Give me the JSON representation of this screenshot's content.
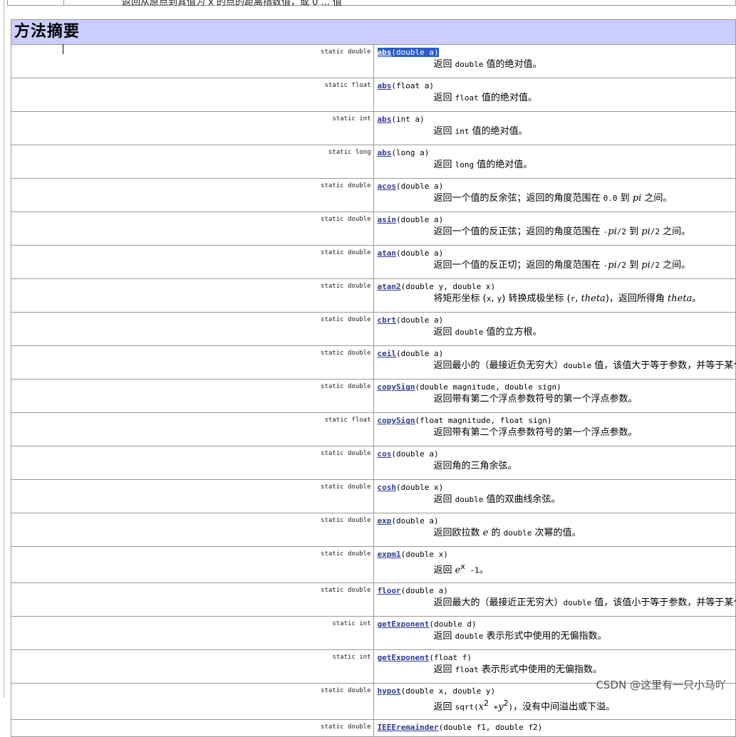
{
  "page": {
    "section_title": "方法摘要",
    "watermark": "CSDN @这里有一只小马吖"
  },
  "top_clip_text": "返回从原点到其值为 x 的点的距离指数值，或 0 ... 值",
  "methods": [
    {
      "type": "static double",
      "name": "abs",
      "params": "(double a)",
      "selected": true,
      "desc": [
        {
          "t": "返回 "
        },
        {
          "c": "double"
        },
        {
          "t": " 值的绝对值。"
        }
      ]
    },
    {
      "type": "static float",
      "name": "abs",
      "params": "(float a)",
      "desc": [
        {
          "t": "返回 "
        },
        {
          "c": "float"
        },
        {
          "t": " 值的绝对值。"
        }
      ]
    },
    {
      "type": "static int",
      "name": "abs",
      "params": "(int a)",
      "desc": [
        {
          "t": "返回 "
        },
        {
          "c": "int"
        },
        {
          "t": " 值的绝对值。"
        }
      ]
    },
    {
      "type": "static long",
      "name": "abs",
      "params": "(long a)",
      "desc": [
        {
          "t": "返回 "
        },
        {
          "c": "long"
        },
        {
          "t": " 值的绝对值。"
        }
      ]
    },
    {
      "type": "static double",
      "name": "acos",
      "params": "(double a)",
      "desc": [
        {
          "t": "返回一个值的反余弦；返回的角度范围在 "
        },
        {
          "c": "0.0"
        },
        {
          "t": " 到 "
        },
        {
          "i": "pi"
        },
        {
          "t": " 之间。"
        }
      ]
    },
    {
      "type": "static double",
      "name": "asin",
      "params": "(double a)",
      "desc": [
        {
          "t": "返回一个值的反正弦；返回的角度范围在 "
        },
        {
          "c": "-"
        },
        {
          "i": "pi"
        },
        {
          "c": "/2"
        },
        {
          "t": " 到 "
        },
        {
          "i": "pi"
        },
        {
          "c": "/2"
        },
        {
          "t": " 之间。"
        }
      ]
    },
    {
      "type": "static double",
      "name": "atan",
      "params": "(double a)",
      "desc": [
        {
          "t": "返回一个值的反正切；返回的角度范围在 "
        },
        {
          "c": "-"
        },
        {
          "i": "pi"
        },
        {
          "c": "/2"
        },
        {
          "t": " 到 "
        },
        {
          "i": "pi"
        },
        {
          "c": "/2"
        },
        {
          "t": " 之间。"
        }
      ]
    },
    {
      "type": "static double",
      "name": "atan2",
      "params": "(double y, double x)",
      "desc": [
        {
          "t": "将矩形坐标 ("
        },
        {
          "c": "x"
        },
        {
          "t": ", "
        },
        {
          "c": "y"
        },
        {
          "t": ") 转换成极坐标 ("
        },
        {
          "c": "r"
        },
        {
          "t": ", "
        },
        {
          "i": "theta"
        },
        {
          "t": ")，返回所得角 "
        },
        {
          "i": "theta"
        },
        {
          "t": "。"
        }
      ]
    },
    {
      "type": "static double",
      "name": "cbrt",
      "params": "(double a)",
      "desc": [
        {
          "t": "返回 "
        },
        {
          "c": "double"
        },
        {
          "t": " 值的立方根。"
        }
      ]
    },
    {
      "type": "static double",
      "name": "ceil",
      "params": "(double a)",
      "desc": [
        {
          "t": "返回最小的（最接近负无穷大）"
        },
        {
          "c": "double"
        },
        {
          "t": " 值，该值大于等于参数，并等于某个整数。"
        }
      ]
    },
    {
      "type": "static double",
      "name": "copySign",
      "params": "(double magnitude, double sign)",
      "desc": [
        {
          "t": "返回带有第二个浮点参数符号的第一个浮点参数。"
        }
      ]
    },
    {
      "type": "static float",
      "name": "copySign",
      "params": "(float magnitude, float sign)",
      "desc": [
        {
          "t": "返回带有第二个浮点参数符号的第一个浮点参数。"
        }
      ]
    },
    {
      "type": "static double",
      "name": "cos",
      "params": "(double a)",
      "desc": [
        {
          "t": "返回角的三角余弦。"
        }
      ]
    },
    {
      "type": "static double",
      "name": "cosh",
      "params": "(double x)",
      "desc": [
        {
          "t": "返回 "
        },
        {
          "c": "double"
        },
        {
          "t": " 值的双曲线余弦。"
        }
      ]
    },
    {
      "type": "static double",
      "name": "exp",
      "params": "(double a)",
      "desc": [
        {
          "t": "返回欧拉数 "
        },
        {
          "i": "e"
        },
        {
          "t": " 的 "
        },
        {
          "c": "double"
        },
        {
          "t": " 次幂的值。"
        }
      ]
    },
    {
      "type": "static double",
      "name": "expm1",
      "params": "(double x)",
      "tall": true,
      "desc": [
        {
          "t": "返回 "
        },
        {
          "i": "e"
        },
        {
          "s": "x"
        },
        {
          "c": " -1"
        },
        {
          "t": "。"
        }
      ]
    },
    {
      "type": "static double",
      "name": "floor",
      "params": "(double a)",
      "desc": [
        {
          "t": "返回最大的（最接近正无穷大）"
        },
        {
          "c": "double"
        },
        {
          "t": " 值，该值小于等于参数，并等于某个整数。"
        }
      ]
    },
    {
      "type": "static int",
      "name": "getExponent",
      "params": "(double d)",
      "desc": [
        {
          "t": "返回 "
        },
        {
          "c": "double"
        },
        {
          "t": " 表示形式中使用的无偏指数。"
        }
      ]
    },
    {
      "type": "static int",
      "name": "getExponent",
      "params": "(float f)",
      "desc": [
        {
          "t": "返回 "
        },
        {
          "c": "float"
        },
        {
          "t": " 表示形式中使用的无偏指数。"
        }
      ]
    },
    {
      "type": "static double",
      "name": "hypot",
      "params": "(double x, double y)",
      "tall": true,
      "desc": [
        {
          "t": "返回 "
        },
        {
          "c": "sqrt("
        },
        {
          "i": "x"
        },
        {
          "s": "2"
        },
        {
          "c": " +"
        },
        {
          "i": "y"
        },
        {
          "s": "2"
        },
        {
          "c": ")"
        },
        {
          "t": "，没有中间溢出或下溢。"
        }
      ]
    },
    {
      "type": "static double",
      "name": "IEEEremainder",
      "params": "(double f1, double f2)",
      "cut": true,
      "desc": []
    }
  ]
}
